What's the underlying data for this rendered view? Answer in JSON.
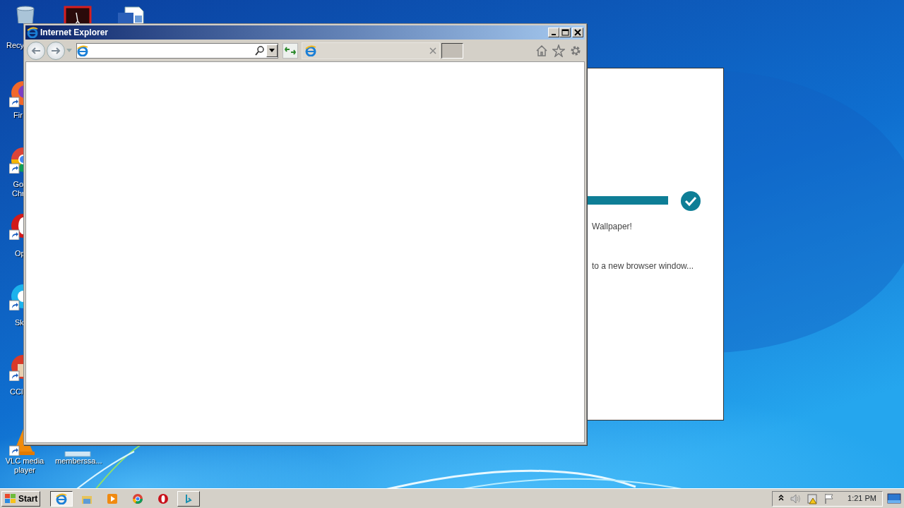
{
  "desktop_icons": [
    {
      "kind": "recycle-bin",
      "label": [
        "Recy"
      ]
    },
    {
      "kind": "pdf"
    },
    {
      "kind": "word"
    },
    {
      "kind": "firefox",
      "shortcut": true,
      "label": [
        "Fir"
      ]
    },
    {
      "kind": "chrome",
      "shortcut": true,
      "label": [
        "Go",
        "Chr"
      ]
    },
    {
      "kind": "opera",
      "shortcut": true,
      "label": [
        "Op"
      ]
    },
    {
      "kind": "skype",
      "shortcut": true,
      "label": [
        "Sk"
      ]
    },
    {
      "kind": "ccleaner",
      "shortcut": true,
      "label": [
        "CCl"
      ]
    },
    {
      "kind": "vlc",
      "shortcut": true,
      "label": [
        "VLC media",
        "player"
      ]
    },
    {
      "kind": "file",
      "shortcut": false,
      "label": [
        "memberssa..."
      ]
    }
  ],
  "background_window": {
    "progress": {
      "level": 1,
      "done": true
    },
    "lines": [
      "Wallpaper!",
      "to a new browser window..."
    ]
  },
  "ie_window": {
    "title": "Internet Explorer",
    "tabs": [
      {
        "selected": true
      }
    ]
  },
  "taskbar": {
    "start_label": "Start",
    "apps": [
      {
        "kind": "ie",
        "running": true,
        "selected": true
      },
      {
        "kind": "explorer",
        "running": false,
        "selected": false
      },
      {
        "kind": "media-player",
        "running": false,
        "selected": false
      },
      {
        "kind": "chrome",
        "running": false,
        "selected": false
      },
      {
        "kind": "opera",
        "running": false,
        "selected": false
      },
      {
        "kind": "bing",
        "running": true,
        "selected": false
      }
    ],
    "tray": [
      {
        "kind": "chevron"
      },
      {
        "kind": "speaker"
      },
      {
        "kind": "network-warning"
      },
      {
        "kind": "flag"
      }
    ],
    "clock": "1:21 PM"
  }
}
